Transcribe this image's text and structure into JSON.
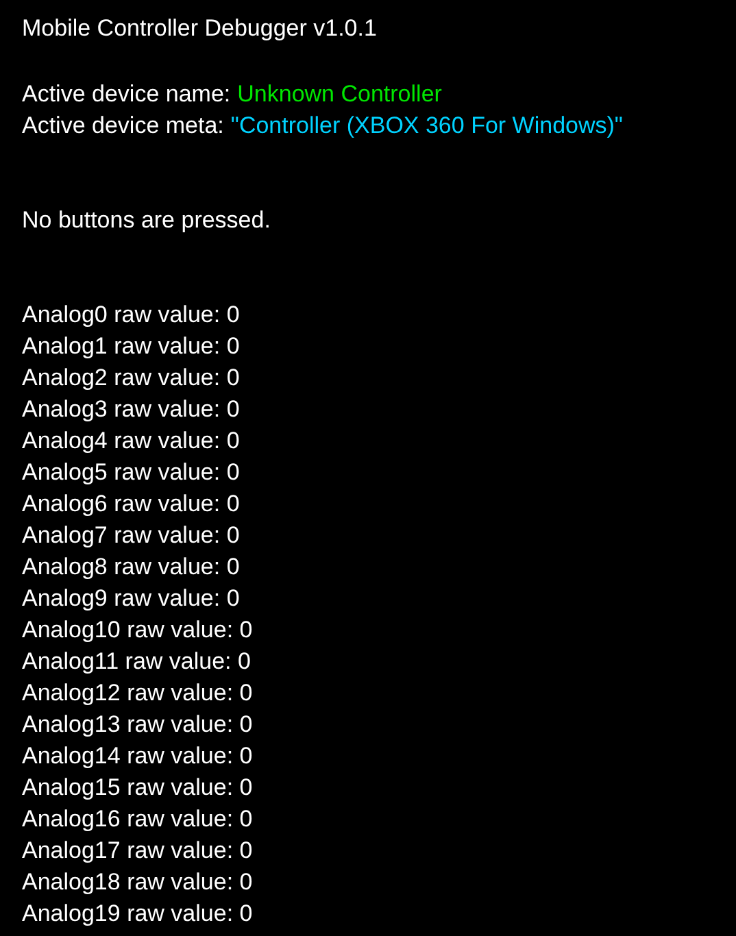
{
  "title": "Mobile Controller Debugger v1.0.1",
  "device_fields": [
    {
      "label": "Active device name:",
      "value": "Unknown Controller",
      "color": "#00e600"
    },
    {
      "label": "Active device meta:",
      "value": "\"Controller (XBOX 360 For Windows)\"",
      "color": "#00d2ff"
    }
  ],
  "buttons_status": "No buttons are pressed.",
  "analogs": [
    "Analog0 raw value: 0",
    "Analog1 raw value: 0",
    "Analog2 raw value: 0",
    "Analog3 raw value: 0",
    "Analog4 raw value: 0",
    "Analog5 raw value: 0",
    "Analog6 raw value: 0",
    "Analog7 raw value: 0",
    "Analog8 raw value: 0",
    "Analog9 raw value: 0",
    "Analog10 raw value: 0",
    "Analog11 raw value: 0",
    "Analog12 raw value: 0",
    "Analog13 raw value: 0",
    "Analog14 raw value: 0",
    "Analog15 raw value: 0",
    "Analog16 raw value: 0",
    "Analog17 raw value: 0",
    "Analog18 raw value: 0",
    "Analog19 raw value: 0"
  ]
}
